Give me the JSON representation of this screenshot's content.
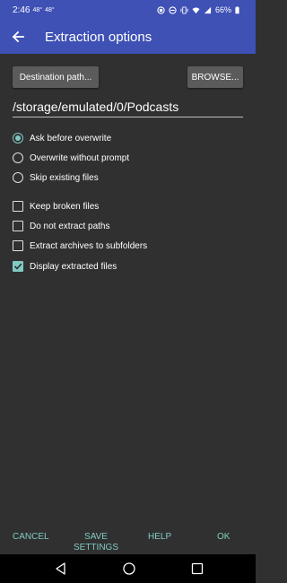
{
  "status_bar": {
    "time": "2:46",
    "temp1": "48°",
    "temp2": "48°",
    "battery_percent": "66%"
  },
  "toolbar": {
    "title": "Extraction options",
    "back_icon": "arrow-back-icon"
  },
  "destination": {
    "path_button_label": "Destination path...",
    "browse_button_label": "BROWSE...",
    "path_value": "/storage/emulated/0/Podcasts"
  },
  "overwrite_options": [
    {
      "label": "Ask before overwrite",
      "selected": true
    },
    {
      "label": "Overwrite without prompt",
      "selected": false
    },
    {
      "label": "Skip existing files",
      "selected": false
    }
  ],
  "checkboxes": [
    {
      "label": "Keep broken files",
      "checked": false
    },
    {
      "label": "Do not extract paths",
      "checked": false
    },
    {
      "label": "Extract archives to subfolders",
      "checked": false
    },
    {
      "label": "Display extracted files",
      "checked": true
    }
  ],
  "actions": {
    "cancel": "CANCEL",
    "save_line1": "SAVE",
    "save_line2": "SETTINGS",
    "help": "HELP",
    "ok": "OK"
  },
  "colors": {
    "primary": "#3f51b5",
    "accent": "#80cbc4",
    "background": "#303030"
  }
}
